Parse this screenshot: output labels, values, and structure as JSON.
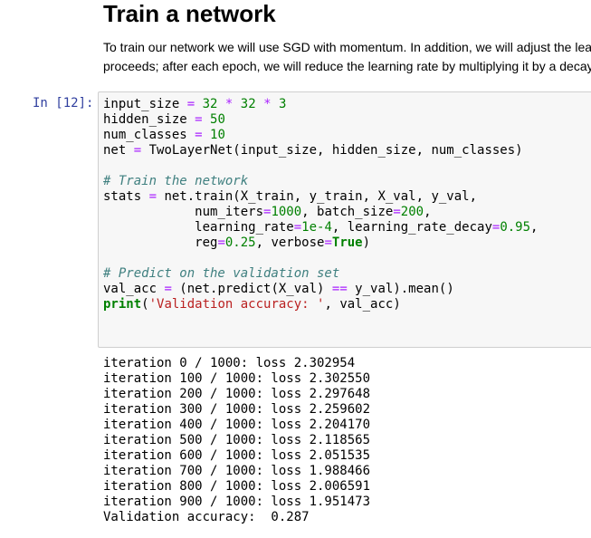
{
  "markdown": {
    "heading": "Train a network",
    "paragraph_lines": [
      "To train our network we will use SGD with momentum. In addition, we will adjust the lea",
      "proceeds; after each epoch, we will reduce the learning rate by multiplying it by a decay"
    ]
  },
  "cell": {
    "prompt": "In [12]:",
    "code_lines": [
      [
        [
          "",
          "input_size "
        ],
        [
          "o",
          "="
        ],
        [
          "",
          " "
        ],
        [
          "n",
          "32"
        ],
        [
          "",
          " "
        ],
        [
          "o",
          "*"
        ],
        [
          "",
          " "
        ],
        [
          "n",
          "32"
        ],
        [
          "",
          " "
        ],
        [
          "o",
          "*"
        ],
        [
          "",
          " "
        ],
        [
          "n",
          "3"
        ]
      ],
      [
        [
          "",
          "hidden_size "
        ],
        [
          "o",
          "="
        ],
        [
          "",
          " "
        ],
        [
          "n",
          "50"
        ]
      ],
      [
        [
          "",
          "num_classes "
        ],
        [
          "o",
          "="
        ],
        [
          "",
          " "
        ],
        [
          "n",
          "10"
        ]
      ],
      [
        [
          "",
          "net "
        ],
        [
          "o",
          "="
        ],
        [
          "",
          " TwoLayerNet(input_size, hidden_size, num_classes)"
        ]
      ],
      [
        [
          "",
          ""
        ]
      ],
      [
        [
          "c",
          "# Train the network"
        ]
      ],
      [
        [
          "",
          "stats "
        ],
        [
          "o",
          "="
        ],
        [
          "",
          " net.train(X_train, y_train, X_val, y_val,"
        ]
      ],
      [
        [
          "",
          "            num_iters"
        ],
        [
          "o",
          "="
        ],
        [
          "n",
          "1000"
        ],
        [
          "",
          ", batch_size"
        ],
        [
          "o",
          "="
        ],
        [
          "n",
          "200"
        ],
        [
          "",
          ","
        ]
      ],
      [
        [
          "",
          "            learning_rate"
        ],
        [
          "o",
          "="
        ],
        [
          "n",
          "1e-4"
        ],
        [
          "",
          ", learning_rate_decay"
        ],
        [
          "o",
          "="
        ],
        [
          "n",
          "0.95"
        ],
        [
          "",
          ","
        ]
      ],
      [
        [
          "",
          "            reg"
        ],
        [
          "o",
          "="
        ],
        [
          "n",
          "0.25"
        ],
        [
          "",
          ", verbose"
        ],
        [
          "o",
          "="
        ],
        [
          "k",
          "True"
        ],
        [
          "",
          ")"
        ]
      ],
      [
        [
          "",
          ""
        ]
      ],
      [
        [
          "c",
          "# Predict on the validation set"
        ]
      ],
      [
        [
          "",
          "val_acc "
        ],
        [
          "o",
          "="
        ],
        [
          "",
          " (net.predict(X_val) "
        ],
        [
          "o",
          "=="
        ],
        [
          "",
          " y_val).mean()"
        ]
      ],
      [
        [
          "k",
          "print"
        ],
        [
          "",
          "("
        ],
        [
          "s",
          "'Validation accuracy: '"
        ],
        [
          "",
          ", val_acc)"
        ]
      ]
    ],
    "output_lines": [
      "iteration 0 / 1000: loss 2.302954",
      "iteration 100 / 1000: loss 2.302550",
      "iteration 200 / 1000: loss 2.297648",
      "iteration 300 / 1000: loss 2.259602",
      "iteration 400 / 1000: loss 2.204170",
      "iteration 500 / 1000: loss 2.118565",
      "iteration 600 / 1000: loss 2.051535",
      "iteration 700 / 1000: loss 1.988466",
      "iteration 800 / 1000: loss 2.006591",
      "iteration 900 / 1000: loss 1.951473",
      "Validation accuracy:  0.287"
    ]
  },
  "colors": {
    "prompt": "#303f9f",
    "operator": "#aa22ff",
    "number": "#008000",
    "comment": "#408080",
    "string": "#ba2121",
    "keyword": "#008000",
    "cell_background": "#f7f7f7",
    "cell_border": "#cfcfcf"
  }
}
